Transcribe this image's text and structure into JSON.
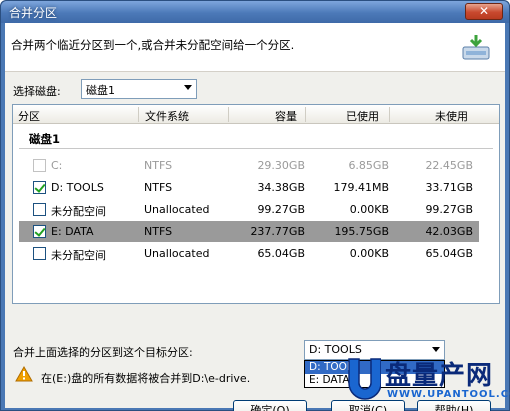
{
  "window": {
    "title": "合并分区",
    "close_glyph": "✕"
  },
  "header": {
    "description": "合并两个临近分区到一个,或合并未分配空间给一个分区."
  },
  "disk_selector": {
    "label": "选择磁盘:",
    "value": "磁盘1"
  },
  "table": {
    "columns": [
      "分区",
      "文件系统",
      "容量",
      "已使用",
      "未使用"
    ],
    "group": "磁盘1",
    "rows": [
      {
        "name": "C:",
        "fs": "NTFS",
        "capacity": "29.30GB",
        "used": "6.85GB",
        "free": "22.45GB",
        "checked": false,
        "disabled": true,
        "selected": false
      },
      {
        "name": "D:  TOOLS",
        "fs": "NTFS",
        "capacity": "34.38GB",
        "used": "179.41MB",
        "free": "33.71GB",
        "checked": true,
        "disabled": false,
        "selected": false
      },
      {
        "name": "未分配空间",
        "fs": "Unallocated",
        "capacity": "99.27GB",
        "used": "0.00KB",
        "free": "99.27GB",
        "checked": false,
        "disabled": false,
        "selected": false
      },
      {
        "name": "E:  DATA",
        "fs": "NTFS",
        "capacity": "237.77GB",
        "used": "195.75GB",
        "free": "42.03GB",
        "checked": true,
        "disabled": false,
        "selected": true
      },
      {
        "name": "未分配空间",
        "fs": "Unallocated",
        "capacity": "65.04GB",
        "used": "0.00KB",
        "free": "65.04GB",
        "checked": false,
        "disabled": false,
        "selected": false
      }
    ]
  },
  "merge": {
    "label": "合并上面选择的分区到这个目标分区:",
    "selected": "D:  TOOLS",
    "options": [
      "D:  TOOLS",
      "E:  DATA"
    ]
  },
  "warning": {
    "text": "在(E:)盘的所有数据将被合并到D:\\e-drive."
  },
  "buttons": {
    "ok": "确定(O)",
    "cancel": "取消(C)",
    "help": "帮助(H)"
  },
  "watermark": {
    "title": "盘量产网",
    "url": "WWW.UPANTOOL.COM"
  },
  "colors": {
    "accent": "#316ac5",
    "selected_row": "#9a9a9a",
    "check": "#21a121",
    "warning": "#f0a000"
  }
}
